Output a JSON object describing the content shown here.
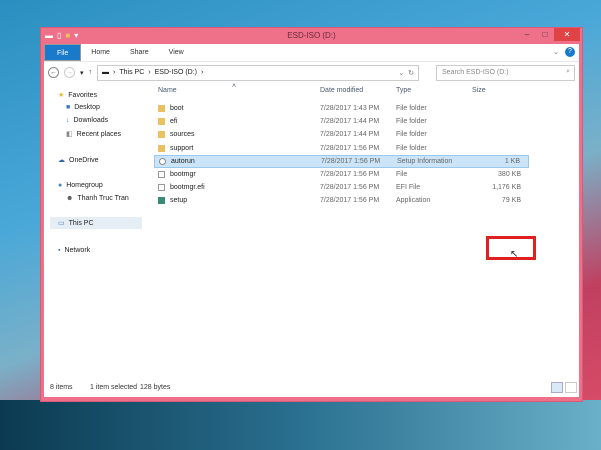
{
  "window": {
    "title": "ESD-ISO (D:)"
  },
  "ribbon": {
    "tabs": [
      "File",
      "Home",
      "Share",
      "View"
    ]
  },
  "address": {
    "segments": [
      "This PC",
      "ESD-ISO (D:)"
    ],
    "search_placeholder": "Search ESD-ISO (D:)"
  },
  "sidebar": {
    "items": [
      {
        "label": "Favorites",
        "icon": "star-icon"
      },
      {
        "label": "Desktop",
        "icon": "desktop-icon"
      },
      {
        "label": "Downloads",
        "icon": "downloads-icon"
      },
      {
        "label": "Recent places",
        "icon": "recent-icon"
      },
      {
        "label": "OneDrive",
        "icon": "cloud-icon"
      },
      {
        "label": "Homegroup",
        "icon": "homegroup-icon"
      },
      {
        "label": "Thanh Truc Tran",
        "icon": "user-icon"
      },
      {
        "label": "This PC",
        "icon": "computer-icon"
      },
      {
        "label": "Network",
        "icon": "network-icon"
      }
    ]
  },
  "columns": {
    "name": "Name",
    "date": "Date modified",
    "type": "Type",
    "size": "Size"
  },
  "files": [
    {
      "name": "boot",
      "date": "7/28/2017 1:43 PM",
      "type": "File folder",
      "size": "",
      "icon": "folder"
    },
    {
      "name": "efi",
      "date": "7/28/2017 1:44 PM",
      "type": "File folder",
      "size": "",
      "icon": "folder"
    },
    {
      "name": "sources",
      "date": "7/28/2017 1:44 PM",
      "type": "File folder",
      "size": "",
      "icon": "folder"
    },
    {
      "name": "support",
      "date": "7/28/2017 1:56 PM",
      "type": "File folder",
      "size": "",
      "icon": "folder"
    },
    {
      "name": "autorun",
      "date": "7/28/2017 1:56 PM",
      "type": "Setup Information",
      "size": "1 KB",
      "icon": "inf",
      "selected": true
    },
    {
      "name": "bootmgr",
      "date": "7/28/2017 1:56 PM",
      "type": "File",
      "size": "380 KB",
      "icon": "file"
    },
    {
      "name": "bootmgr.efi",
      "date": "7/28/2017 1:56 PM",
      "type": "EFI File",
      "size": "1,176 KB",
      "icon": "file"
    },
    {
      "name": "setup",
      "date": "7/28/2017 1:56 PM",
      "type": "Application",
      "size": "79 KB",
      "icon": "app"
    }
  ],
  "status": {
    "count": "8 items",
    "selection": "1 item selected",
    "size": "128 bytes"
  },
  "colors": {
    "frame": "#ef7089",
    "accent": "#1979ca",
    "highlight": "#e02020",
    "selection": "#cce4f7"
  }
}
